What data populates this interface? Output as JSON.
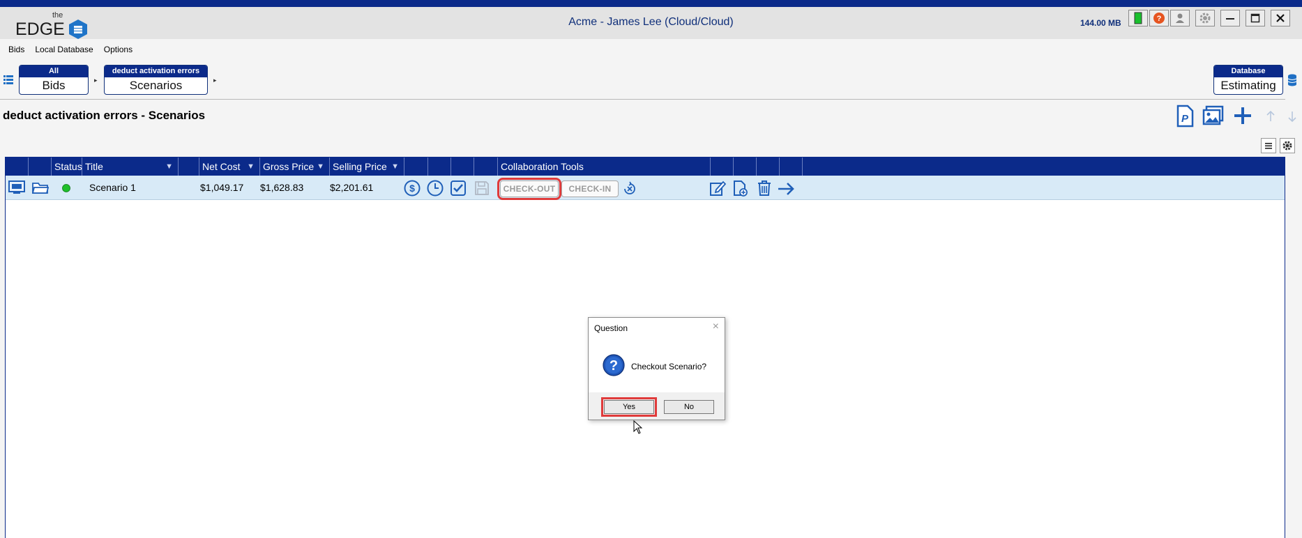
{
  "app": {
    "logo_the": "the",
    "logo_edge": "EDGE",
    "window_title": "Acme  - James Lee (Cloud/Cloud)",
    "memory": "144.00 MB",
    "accent": "#0b2a8a"
  },
  "menu": [
    "Bids",
    "Local Database",
    "Options"
  ],
  "breadcrumbs": [
    {
      "header": "All",
      "label": "Bids"
    },
    {
      "header": "deduct activation errors",
      "label": "Scenarios"
    }
  ],
  "database": {
    "header": "Database",
    "label": "Estimating"
  },
  "page": {
    "title": "deduct activation errors   - Scenarios"
  },
  "grid": {
    "columns": {
      "status": "Status",
      "title": "Title",
      "net_cost": "Net Cost",
      "gross_price": "Gross Price",
      "selling_price": "Selling Price",
      "collab": "Collaboration Tools"
    },
    "rows": [
      {
        "status_color": "#1fbf2b",
        "title": "Scenario 1",
        "net_cost": "$1,049.17",
        "gross_price": "$1,628.83",
        "selling_price": "$2,201.61",
        "checkout_label": "CHECK-OUT",
        "checkin_label": "CHECK-IN"
      }
    ]
  },
  "dialog": {
    "title": "Question",
    "message": "Checkout Scenario?",
    "yes_label": "Yes",
    "no_label": "No"
  },
  "icons": [
    "list-icon",
    "database-icon",
    "pdf-icon",
    "image-icon",
    "plus-icon",
    "up-arrow-icon",
    "down-arrow-icon",
    "menu-icon",
    "gear-icon",
    "question-icon"
  ]
}
